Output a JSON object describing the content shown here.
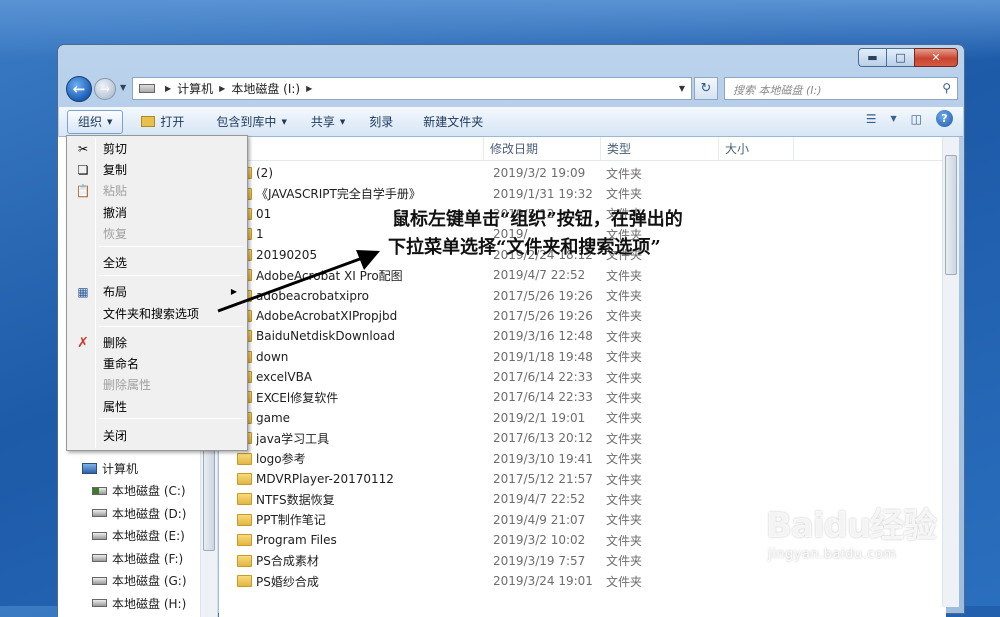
{
  "window": {
    "caption_buttons": [
      "minimize",
      "maximize",
      "close"
    ]
  },
  "nav": {
    "breadcrumbs": [
      "计算机",
      "本地磁盘 (I:)"
    ],
    "search_placeholder": "搜索 本地磁盘 (I:)"
  },
  "toolbar": {
    "organize": "组织",
    "open": "打开",
    "include_in_library": "包含到库中",
    "share": "共享",
    "burn": "刻录",
    "new_folder": "新建文件夹"
  },
  "columns": {
    "name": "称",
    "modified": "修改日期",
    "type": "类型",
    "size": "大小"
  },
  "files": [
    {
      "name": "(2)",
      "date": "2019/3/2 19:09",
      "type": "文件夹"
    },
    {
      "name": "《JAVASCRIPT完全自学手册》",
      "date": "2019/1/31 19:32",
      "type": "文件夹"
    },
    {
      "name": "01",
      "date": "2019/5/12",
      "type": "文件夹"
    },
    {
      "name": "1",
      "date": "2019/",
      "type": "文件夹"
    },
    {
      "name": "20190205",
      "date": "2019/2/24 18:12",
      "type": "文件夹"
    },
    {
      "name": "AdobeAcrobat XI Pro配图",
      "date": "2019/4/7 22:52",
      "type": "文件夹"
    },
    {
      "name": "adobeacrobatxipro",
      "date": "2017/5/26 19:26",
      "type": "文件夹"
    },
    {
      "name": "AdobeAcrobatXIPropjbd",
      "date": "2017/5/26 19:26",
      "type": "文件夹"
    },
    {
      "name": "BaiduNetdiskDownload",
      "date": "2019/3/16 12:48",
      "type": "文件夹"
    },
    {
      "name": "down",
      "date": "2019/1/18 19:48",
      "type": "文件夹"
    },
    {
      "name": "excelVBA",
      "date": "2017/6/14 22:33",
      "type": "文件夹"
    },
    {
      "name": "EXCEl修复软件",
      "date": "2017/6/14 22:33",
      "type": "文件夹"
    },
    {
      "name": "game",
      "date": "2019/2/1 19:01",
      "type": "文件夹"
    },
    {
      "name": "java学习工具",
      "date": "2017/6/13 20:12",
      "type": "文件夹"
    },
    {
      "name": "logo参考",
      "date": "2019/3/10 19:41",
      "type": "文件夹"
    },
    {
      "name": "MDVRPlayer-20170112",
      "date": "2017/5/12 21:57",
      "type": "文件夹"
    },
    {
      "name": "NTFS数据恢复",
      "date": "2019/4/7 22:52",
      "type": "文件夹"
    },
    {
      "name": "PPT制作笔记",
      "date": "2019/4/9 21:07",
      "type": "文件夹"
    },
    {
      "name": "Program Files",
      "date": "2019/3/2 10:02",
      "type": "文件夹"
    },
    {
      "name": "PS合成素材",
      "date": "2019/3/19 7:57",
      "type": "文件夹"
    },
    {
      "name": "PS婚纱合成",
      "date": "2019/3/24 19:01",
      "type": "文件夹"
    }
  ],
  "navpane": {
    "computer": "计算机",
    "drives": [
      "本地磁盘 (C:)",
      "本地磁盘 (D:)",
      "本地磁盘 (E:)",
      "本地磁盘 (F:)",
      "本地磁盘 (G:)",
      "本地磁盘 (H:)"
    ]
  },
  "menu": {
    "items": [
      {
        "label": "剪切",
        "icon": "scissors-icon",
        "enabled": true
      },
      {
        "label": "复制",
        "icon": "copy-icon",
        "enabled": true
      },
      {
        "label": "粘贴",
        "icon": "paste-icon",
        "enabled": false
      },
      {
        "label": "撤消",
        "icon": "",
        "enabled": true
      },
      {
        "label": "恢复",
        "icon": "",
        "enabled": false
      },
      {
        "label": "全选",
        "icon": "",
        "enabled": true
      },
      {
        "label": "布局",
        "icon": "layout-icon",
        "enabled": true,
        "submenu": true
      },
      {
        "label": "文件夹和搜索选项",
        "icon": "",
        "enabled": true
      },
      {
        "label": "删除",
        "icon": "delete-x-icon",
        "enabled": true
      },
      {
        "label": "重命名",
        "icon": "",
        "enabled": true
      },
      {
        "label": "删除属性",
        "icon": "",
        "enabled": false
      },
      {
        "label": "属性",
        "icon": "",
        "enabled": true
      },
      {
        "label": "关闭",
        "icon": "",
        "enabled": true
      }
    ]
  },
  "annotation": {
    "line1": "鼠标左键单击“组织”按钮，在弹出的",
    "line2": "下拉菜单选择“文件夹和搜索选项”"
  },
  "watermark": {
    "brand": "Baidu经验",
    "url": "jingyan.baidu.com"
  },
  "colors": {
    "desktop": "#2a6fbe",
    "annotation_arrow": "#000000",
    "delete_icon": "#d03a2a"
  }
}
